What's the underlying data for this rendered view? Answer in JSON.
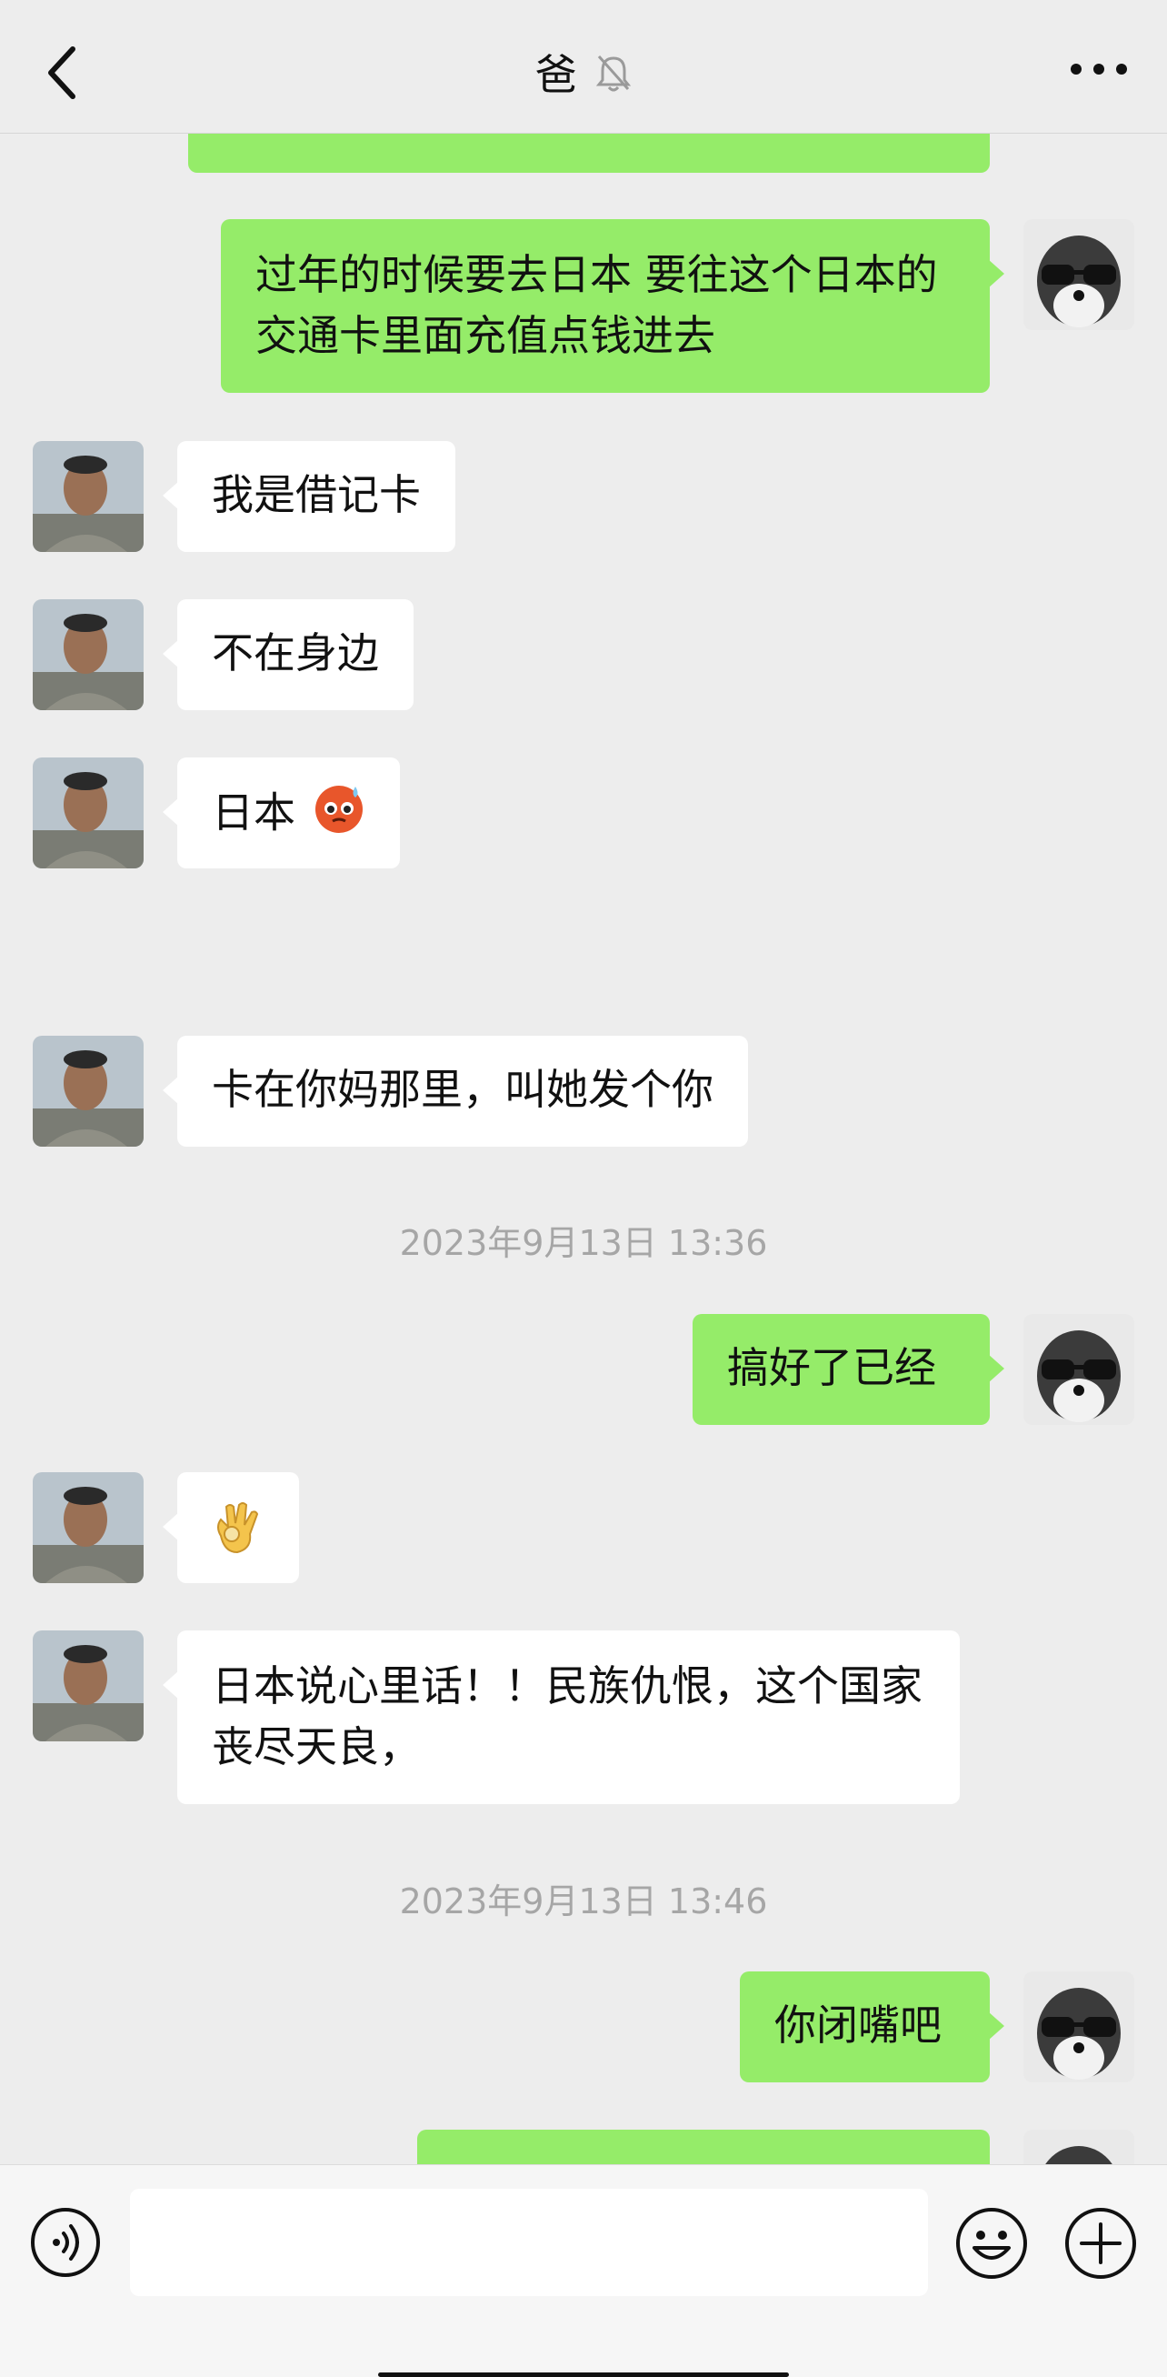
{
  "header": {
    "title": "爸",
    "back_icon": "chevron-left-icon",
    "mute_icon": "bell-slash-icon",
    "more_icon": "ellipsis-icon"
  },
  "messages": [
    {
      "side": "right",
      "text": "过年的时候要去日本 要往这个日本的交通卡里面充值点钱进去"
    },
    {
      "side": "left",
      "text": "我是借记卡"
    },
    {
      "side": "left",
      "text": "不在身边"
    },
    {
      "side": "left",
      "text": "日本"
    },
    {
      "side": "left",
      "text": "卡在你妈那里，叫她发个你"
    },
    {
      "side": "right",
      "text": "搞好了已经"
    },
    {
      "side": "left",
      "text": ""
    },
    {
      "side": "left",
      "text": "日本说心里话！！民族仇恨，这个国家丧尽天良，"
    },
    {
      "side": "right",
      "text": "你闭嘴吧"
    }
  ],
  "timestamps": [
    "2023年9月13日 13:36",
    "2023年9月13日 13:46"
  ],
  "input_bar": {
    "placeholder": "",
    "voice_icon": "voice-icon",
    "emoji_icon": "emoji-icon",
    "plus_icon": "plus-icon"
  },
  "colors": {
    "sent_bubble": "#95ec69",
    "received_bubble": "#ffffff",
    "background": "#ededed"
  }
}
